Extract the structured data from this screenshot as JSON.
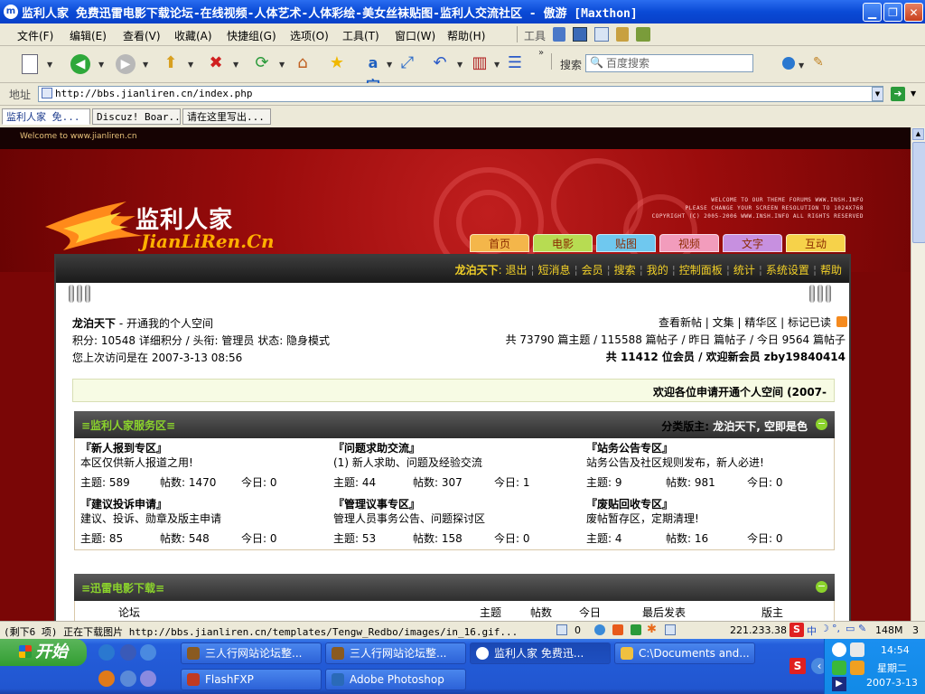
{
  "window": {
    "title": "监利人家 免费迅雷电影下载论坛-在线视频-人体艺术-人体彩绘-美女丝袜贴图-监利人交流社区 - 傲游 [Maxthon]",
    "app_icon": "m"
  },
  "menubar": {
    "items": [
      "文件(F)",
      "编辑(E)",
      "查看(V)",
      "收藏(A)",
      "快捷组(G)",
      "选项(O)",
      "工具(T)",
      "窗口(W)",
      "帮助(H)"
    ],
    "tools_label": "工具"
  },
  "toolbar": {
    "search_label": "搜索",
    "search_placeholder": "百度搜索"
  },
  "address": {
    "label": "地址",
    "url": "http://bbs.jianliren.cn/index.php"
  },
  "tabs": [
    "监利人家 免...",
    "Discuz! Boar...",
    "请在这里写出..."
  ],
  "site": {
    "welcome": "Welcome to www.jianliren.cn",
    "logo_cn": "监利人家",
    "logo_en": "JianLiRen.Cn",
    "credits": [
      "WELCOME TO OUR THEME FORUMS WWW.INSH.INFO",
      "PLEASE CHANGE YOUR SCREEN RESOLUTION TO 1024X768",
      "COPYRIGHT (C) 2005-2006 WWW.INSH.INFO ALL RIGHTS RESERVED"
    ],
    "nav_tabs": [
      {
        "label": "首页",
        "color": "#f4b64a"
      },
      {
        "label": "电影",
        "color": "#b7dc52"
      },
      {
        "label": "贴图",
        "color": "#6fc8ef"
      },
      {
        "label": "视频",
        "color": "#f29cbc"
      },
      {
        "label": "文字",
        "color": "#c790e0"
      },
      {
        "label": "互动",
        "color": "#f6d24a"
      }
    ]
  },
  "userbar": {
    "username": "龙泊天下",
    "links": [
      "退出",
      "短消息",
      "会员",
      "搜索",
      "我的",
      "控制面板",
      "统计",
      "系统设置",
      "帮助"
    ]
  },
  "profile": {
    "line1_name": "龙泊天下",
    "line1_rest": " - 开通我的个人空间",
    "line2": "积分: 10548 详细积分 / 头衔: 管理员  状态: 隐身模式",
    "line3": "您上次访问是在  2007-3-13 08:56",
    "right_links": "查看新帖 | 文集 | 精华区 | 标记已读",
    "stats1": "共 73790 篇主题 / 115588 篇帖子 / 昨日 篇帖子 / 今日 9564 篇帖子",
    "stats2": "共 11412 位会员 / 欢迎新会员  zby19840414"
  },
  "notice": "欢迎各位申请开通个人空间  (2007-",
  "section1": {
    "title": "≡监利人家服务区≡",
    "moderator_label": "分类版主: ",
    "moderators": "龙泊天下, 空即是色",
    "forums": [
      {
        "name": "『新人报到专区』",
        "desc": "本区仅供新人报道之用!",
        "topics": "主题: 589",
        "posts": "帖数: 1470",
        "today": "今日: 0"
      },
      {
        "name": "『问题求助交流』",
        "desc": "(1) 新人求助、问题及经验交流",
        "topics": "主题: 44",
        "posts": "帖数: 307",
        "today": "今日: 1"
      },
      {
        "name": "『站务公告专区』",
        "desc": "站务公告及社区规则发布，新人必进!",
        "topics": "主题: 9",
        "posts": "帖数: 981",
        "today": "今日: 0"
      },
      {
        "name": "『建议投诉申请』",
        "desc": "建议、投诉、勋章及版主申请",
        "topics": "主题: 85",
        "posts": "帖数: 548",
        "today": "今日: 0"
      },
      {
        "name": "『管理议事专区』",
        "desc": "管理人员事务公告、问题探讨区",
        "topics": "主题: 53",
        "posts": "帖数: 158",
        "today": "今日: 0"
      },
      {
        "name": "『废贴回收专区』",
        "desc": "废帖暂存区，定期清理!",
        "topics": "主题: 4",
        "posts": "帖数: 16",
        "today": "今日: 0"
      }
    ]
  },
  "section2": {
    "title": "≡迅雷电影下载≡",
    "columns": [
      "论坛",
      "主题",
      "帖数",
      "今日",
      "最后发表",
      "版主"
    ]
  },
  "statusbar": {
    "text": "(剩下6 项) 正在下载图片 http://bbs.jianliren.cn/templates/Tengw_Redbo/images/in_16.gif...",
    "count": "0",
    "ip": "221.233.38",
    "memory": "148M",
    "num": "3"
  },
  "taskbar": {
    "start": "开始",
    "row1": [
      "三人行网站论坛整...",
      "三人行网站论坛整...",
      "监利人家 免费迅...",
      "C:\\Documents and..."
    ],
    "row2": [
      "FlashFXP",
      "Adobe Photoshop"
    ],
    "time": "14:54",
    "weekday": "星期二",
    "date": "2007-3-13"
  }
}
